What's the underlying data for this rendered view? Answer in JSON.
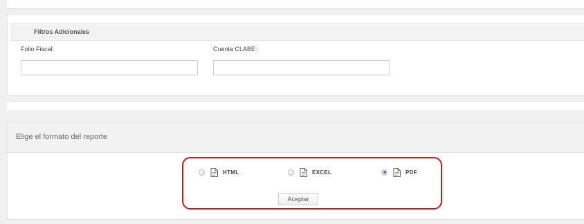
{
  "filters": {
    "title": "Filtros Adicionales",
    "folio_fiscal": {
      "label": "Folio Fiscal:",
      "value": "",
      "placeholder": ""
    },
    "cuenta_clabe": {
      "label": "Cuenta CLABE:",
      "value": "",
      "placeholder": ""
    }
  },
  "report_format": {
    "title": "Elige el formato del reporte",
    "options": [
      {
        "label": "HTML",
        "selected": false,
        "icon": "document-icon"
      },
      {
        "label": "EXCEL",
        "selected": false,
        "icon": "document-icon"
      },
      {
        "label": "PDF",
        "selected": true,
        "icon": "document-icon"
      }
    ],
    "accept_label": "Aceptar"
  },
  "colors": {
    "highlight": "#e0101a",
    "radio_selected": "#3d6fb6"
  }
}
